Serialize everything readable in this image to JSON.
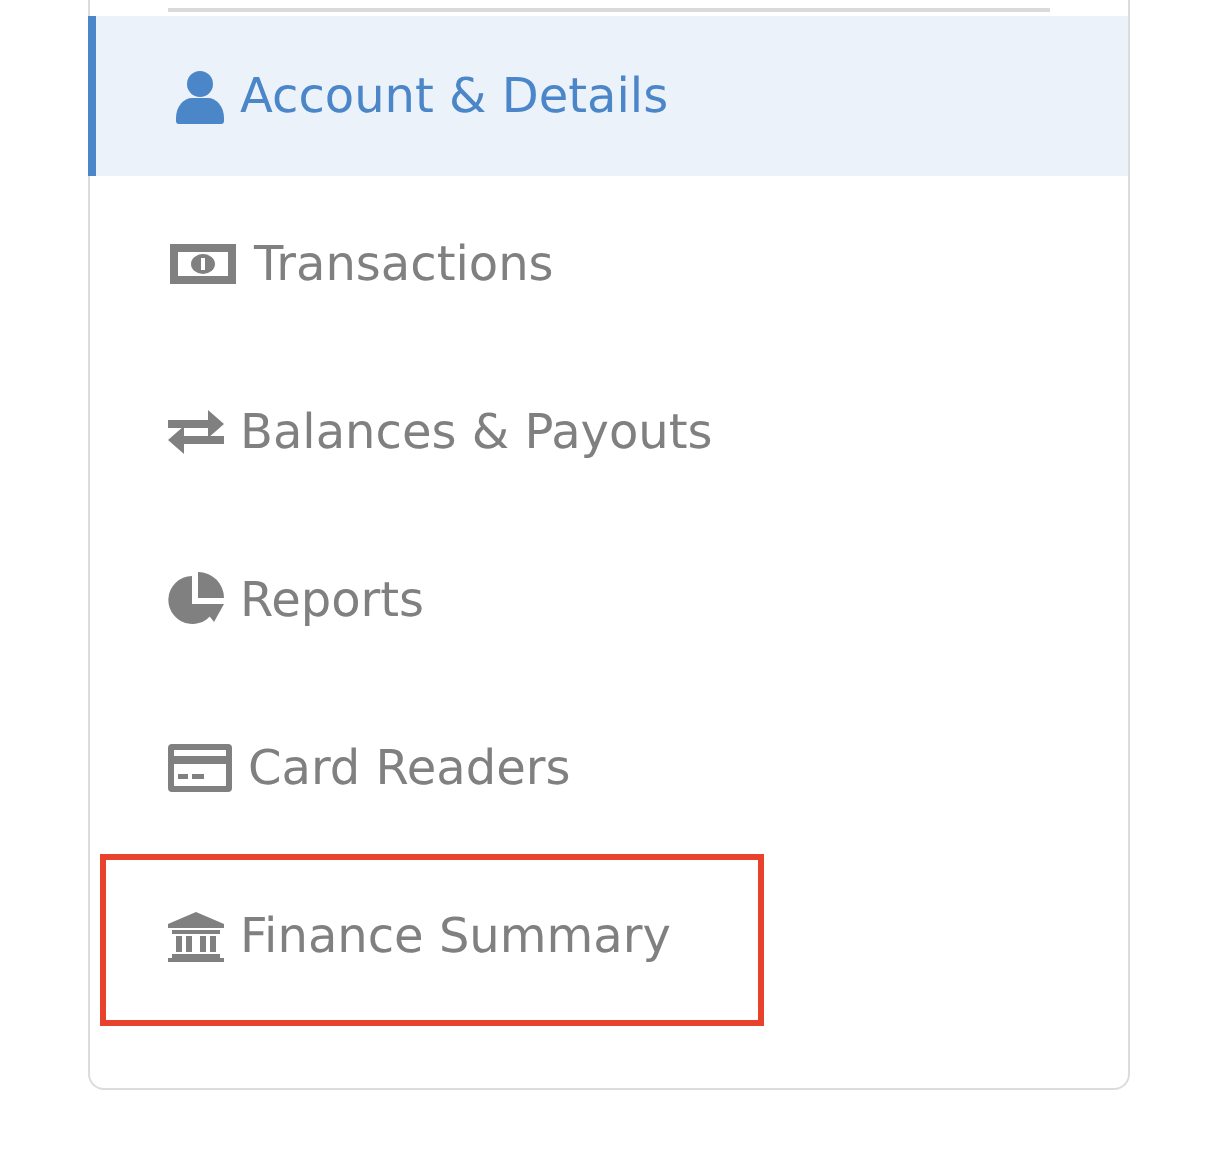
{
  "sidebar": {
    "items": [
      {
        "label": "Account & Details",
        "selected": true,
        "highlighted": false
      },
      {
        "label": "Transactions",
        "selected": false,
        "highlighted": false
      },
      {
        "label": "Balances & Payouts",
        "selected": false,
        "highlighted": false
      },
      {
        "label": "Reports",
        "selected": false,
        "highlighted": false
      },
      {
        "label": "Card Readers",
        "selected": false,
        "highlighted": false
      },
      {
        "label": "Finance Summary",
        "selected": false,
        "highlighted": true
      }
    ]
  }
}
